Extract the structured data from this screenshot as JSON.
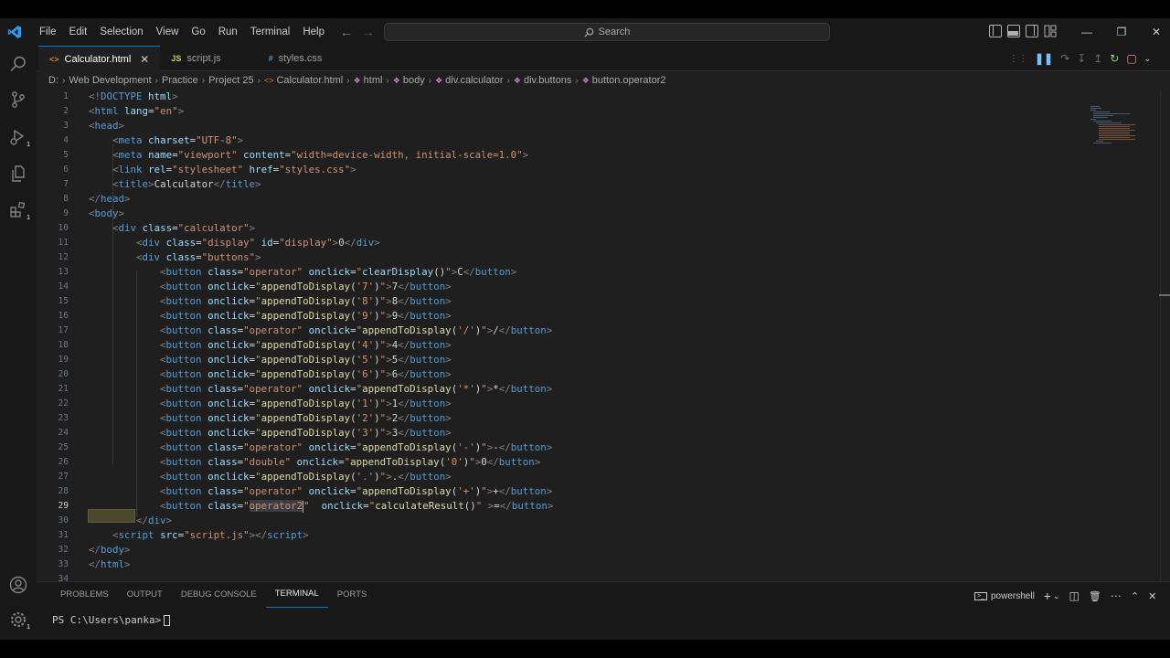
{
  "menu": [
    "File",
    "Edit",
    "Selection",
    "View",
    "Go",
    "Run",
    "Terminal",
    "Help"
  ],
  "search": {
    "placeholder": "Search"
  },
  "tabs": [
    {
      "label": "Calculator.html",
      "icon": "html-file-icon",
      "active": true
    },
    {
      "label": "script.js",
      "icon": "js-file-icon",
      "icon_text": "JS",
      "active": false
    },
    {
      "label": "styles.css",
      "icon": "css-file-icon",
      "icon_text": "#",
      "active": false
    }
  ],
  "breadcrumb": [
    "D:",
    "Web Development",
    "Practice",
    "Project 25",
    "Calculator.html",
    "html",
    "body",
    "div.calculator",
    "div.buttons",
    "button.operator2"
  ],
  "editor": {
    "current_line": 29,
    "line_numbers": [
      "1",
      "2",
      "3",
      "4",
      "5",
      "6",
      "7",
      "8",
      "9",
      "10",
      "11",
      "12",
      "13",
      "14",
      "15",
      "16",
      "17",
      "18",
      "19",
      "20",
      "21",
      "22",
      "23",
      "24",
      "25",
      "26",
      "27",
      "28",
      "29",
      "30",
      "31",
      "32",
      "33",
      "34"
    ]
  },
  "panel": {
    "tabs": [
      "PROBLEMS",
      "OUTPUT",
      "DEBUG CONSOLE",
      "TERMINAL",
      "PORTS"
    ],
    "active_tab": "TERMINAL",
    "shell": "powershell",
    "prompt": "PS C:\\Users\\panka>"
  },
  "colors": {
    "accent": "#0078d4",
    "tag": "#569cd6",
    "attr": "#9cdcfe",
    "string": "#ce9178",
    "function": "#dcdcaa"
  }
}
